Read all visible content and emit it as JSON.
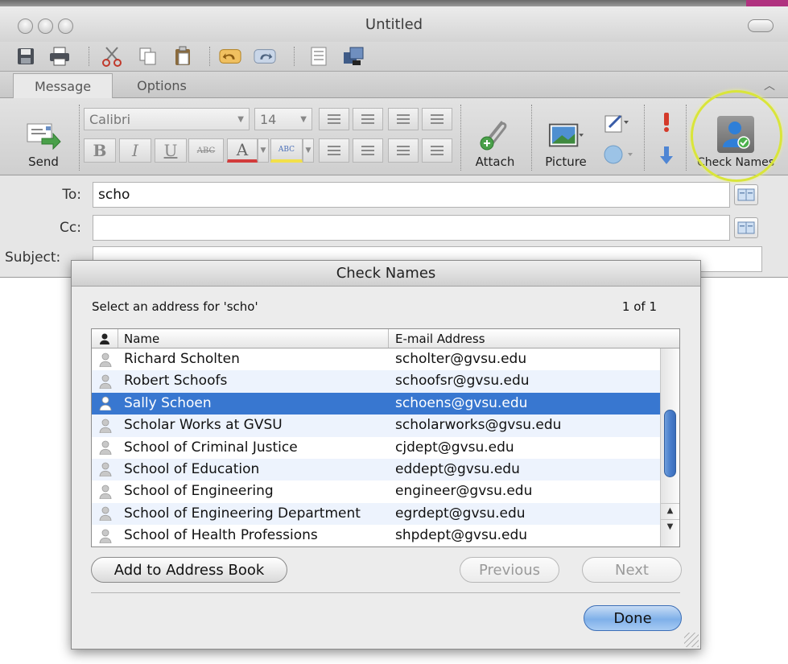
{
  "window": {
    "title": "Untitled"
  },
  "quick_toolbar": {
    "icons": [
      "save-icon",
      "print-icon",
      "cut-icon",
      "copy-icon",
      "paste-icon",
      "undo-icon",
      "redo-icon",
      "signature-icon",
      "address-book-icon"
    ]
  },
  "tabs": [
    {
      "label": "Message",
      "active": true
    },
    {
      "label": "Options",
      "active": false
    }
  ],
  "ribbon": {
    "send_label": "Send",
    "font_name": "Calibri",
    "font_size": "14",
    "format_buttons": [
      "B",
      "I",
      "U",
      "ABC",
      "A",
      "ABC"
    ],
    "attach_label": "Attach",
    "picture_label": "Picture",
    "check_names_label": "Check Names"
  },
  "header": {
    "to_label": "To:",
    "to_value": "scho",
    "cc_label": "Cc:",
    "cc_value": "",
    "subject_label": "Subject:"
  },
  "dialog": {
    "title": "Check Names",
    "prompt": "Select an address for 'scho'",
    "counter": "1 of 1",
    "columns": {
      "name": "Name",
      "email": "E-mail Address"
    },
    "rows": [
      {
        "name": "Richard Scholten",
        "email": "scholter@gvsu.edu",
        "selected": false
      },
      {
        "name": "Robert Schoofs",
        "email": "schoofsr@gvsu.edu",
        "selected": false
      },
      {
        "name": "Sally Schoen",
        "email": "schoens@gvsu.edu",
        "selected": true
      },
      {
        "name": "Scholar Works at GVSU",
        "email": "scholarworks@gvsu.edu",
        "selected": false
      },
      {
        "name": "School of Criminal Justice",
        "email": "cjdept@gvsu.edu",
        "selected": false
      },
      {
        "name": "School of Education",
        "email": "eddept@gvsu.edu",
        "selected": false
      },
      {
        "name": "School of Engineering",
        "email": "engineer@gvsu.edu",
        "selected": false
      },
      {
        "name": "School of Engineering Department",
        "email": "egrdept@gvsu.edu",
        "selected": false
      },
      {
        "name": "School of Health Professions",
        "email": "shpdept@gvsu.edu",
        "selected": false
      }
    ],
    "add_button": "Add to Address Book",
    "previous_button": "Previous",
    "next_button": "Next",
    "done_button": "Done"
  },
  "colors": {
    "selection": "#3877d0",
    "default_button": "#7fb0e9",
    "highlight_ring": "#d9e53a",
    "row_stripe": "#edf3fd"
  }
}
